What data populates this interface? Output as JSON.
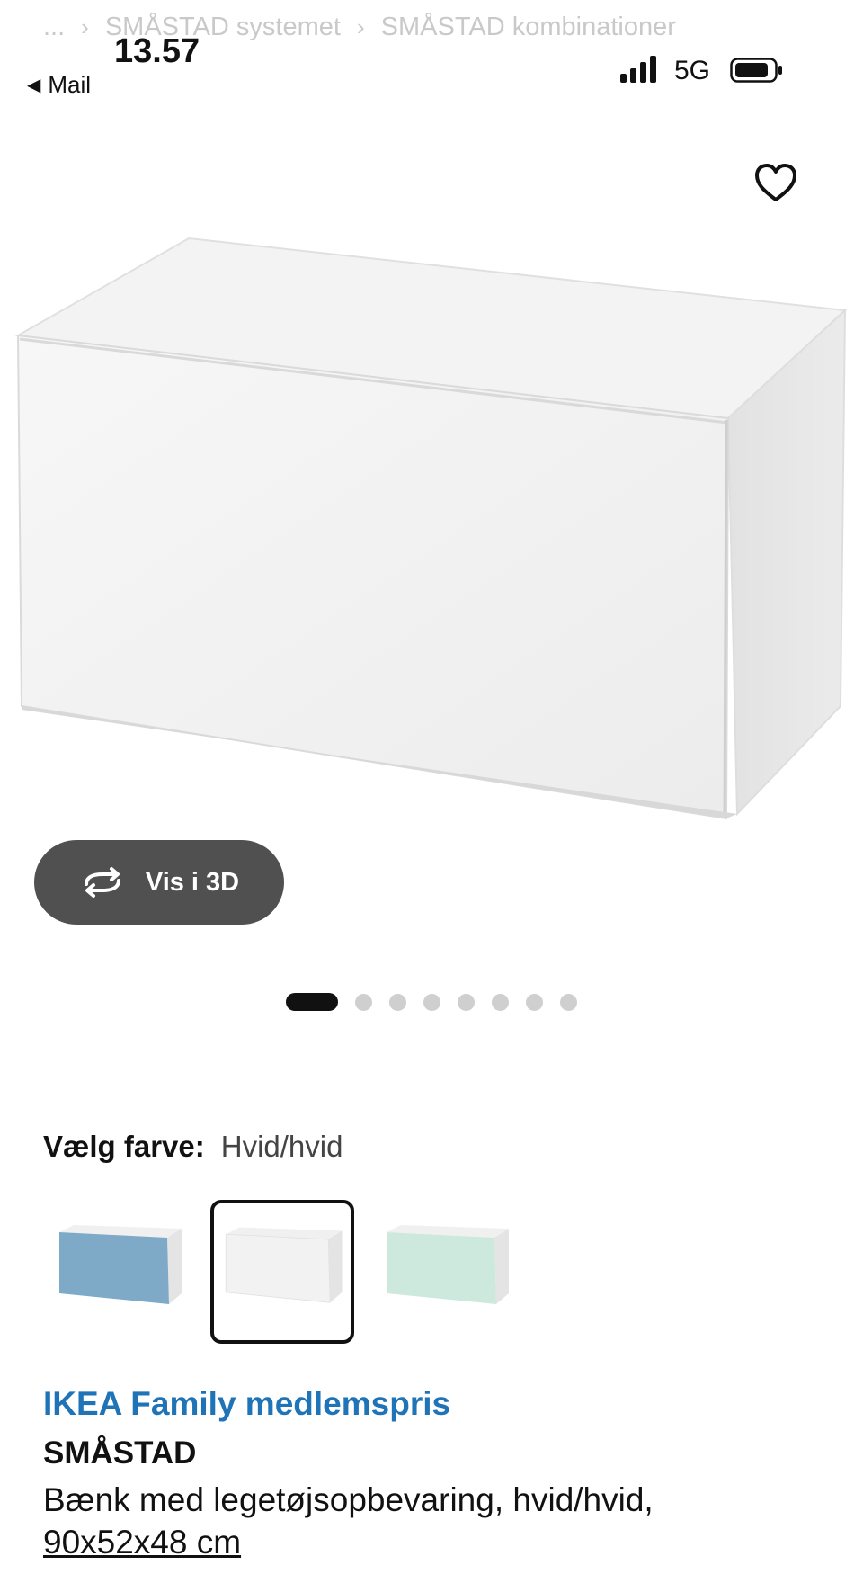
{
  "breadcrumb": {
    "ellipsis": "...",
    "items": [
      "SMÅSTAD systemet",
      "SMÅSTAD kombinationer"
    ]
  },
  "status_bar": {
    "time": "13.57",
    "back_label": "Mail",
    "network": "5G"
  },
  "product_image": {
    "favorite_icon": "heart-outline-icon",
    "view_3d_label": "Vis i 3D",
    "carousel": {
      "total": 8,
      "active_index": 0
    }
  },
  "color_selector": {
    "label": "Vælg farve:",
    "selected": "Hvid/hvid",
    "swatches": [
      {
        "front": "#7eaac8",
        "selected": false
      },
      {
        "front": "#f2f2f2",
        "selected": true
      },
      {
        "front": "#cde8dc",
        "selected": false
      }
    ]
  },
  "product": {
    "family_label": "IKEA Family medlemspris",
    "name": "SMÅSTAD",
    "description": "Bænk med legetøjsopbevaring, hvid/hvid,",
    "dimensions": "90x52x48 cm"
  },
  "colors": {
    "family_blue": "#1f73b7",
    "button_grey": "#505050"
  }
}
